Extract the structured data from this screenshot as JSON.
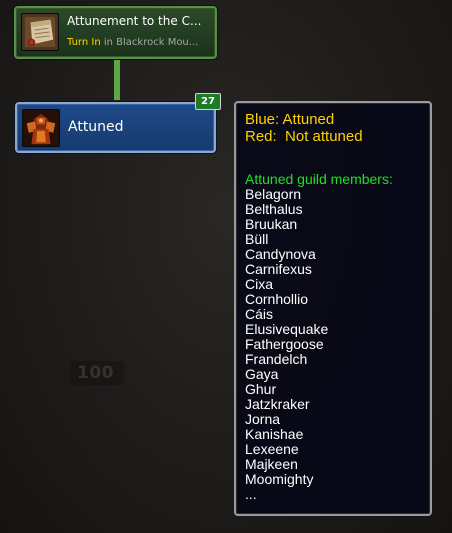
{
  "quest_node": {
    "title": "Attunement to the C...",
    "status": "Turn In",
    "location": "in Blackrock Mou..."
  },
  "attuned_node": {
    "label": "Attuned",
    "count_badge": "27"
  },
  "background": {
    "faded_number": "100"
  },
  "tooltip": {
    "legend_blue": "Blue: Attuned",
    "legend_red": "Red:  Not attuned",
    "members_header": "Attuned guild members:",
    "members": [
      "Belagorn",
      "Belthalus",
      "Bruukan",
      "Büll",
      "Candynova",
      "Carnifexus",
      "Cixa",
      "Cornhollio",
      "Cáis",
      "Elusivequake",
      "Fathergoose",
      "Frandelch",
      "Gaya",
      "Ghur",
      "Jatzkraker",
      "Jorna",
      "Kanishae",
      "Lexeene",
      "Majkeen",
      "Moomighty",
      "..."
    ]
  },
  "colors": {
    "quest_node_bg": "#2c4a2a",
    "attuned_node_bg": "#1f4a88",
    "connector": "#5fa543",
    "badge_bg": "#1f7a25",
    "legend_text": "#ffd100",
    "members_header": "#20e020",
    "turn_in_text": "#ffd100"
  },
  "icons": {
    "quest_icon": "scroll-icon",
    "attuned_icon": "armored-warrior-icon"
  }
}
